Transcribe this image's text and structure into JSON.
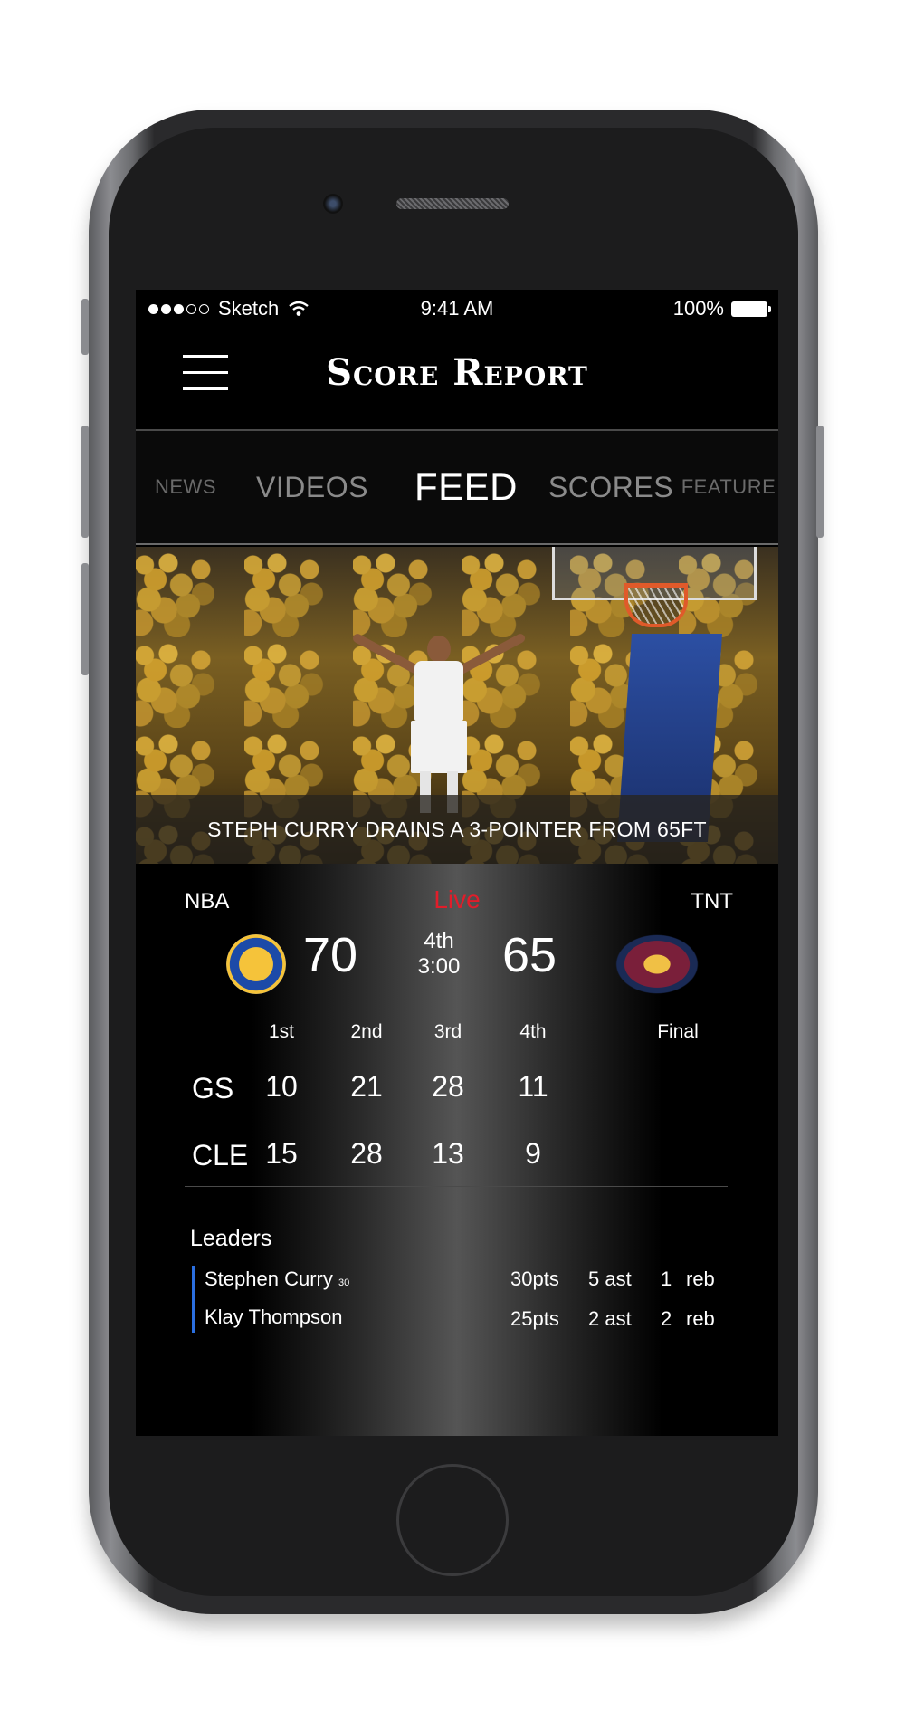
{
  "status_bar": {
    "carrier": "Sketch",
    "time": "9:41 AM",
    "battery": "100%",
    "signal_dots_filled": 3,
    "signal_dots_total": 5
  },
  "header": {
    "title": "Score Report",
    "menu_icon": "hamburger-icon"
  },
  "tabs": [
    {
      "label": "NEWS",
      "active": false
    },
    {
      "label": "VIDEOS",
      "active": false
    },
    {
      "label": "FEED",
      "active": true
    },
    {
      "label": "SCORES",
      "active": false
    },
    {
      "label": "FEATURE",
      "active": false
    }
  ],
  "hero": {
    "caption": "STEPH CURRY DRAINS A 3-POINTER FROM 65FT"
  },
  "game": {
    "league": "NBA",
    "status": "Live",
    "network": "TNT",
    "home": {
      "abbr": "GS",
      "score": "70",
      "logo": "warriors-logo-icon"
    },
    "away": {
      "abbr": "CLE",
      "score": "65",
      "logo": "cavaliers-logo-icon"
    },
    "period": "4th",
    "clock": "3:00",
    "quarter_headers": [
      "1st",
      "2nd",
      "3rd",
      "4th",
      "Final"
    ],
    "lines": [
      {
        "team": "GS",
        "q": [
          "10",
          "21",
          "28",
          "11"
        ]
      },
      {
        "team": "CLE",
        "q": [
          "15",
          "28",
          "13",
          "9"
        ]
      }
    ]
  },
  "leaders": {
    "title": "Leaders",
    "rows": [
      {
        "name": "Stephen Curry",
        "number": "30",
        "pts": "30pts",
        "ast": "5 ast",
        "reb_num": "1",
        "reb_label": "reb"
      },
      {
        "name": "Klay Thompson",
        "number": "",
        "pts": "25pts",
        "ast": "2 ast",
        "reb_num": "2",
        "reb_label": "reb"
      }
    ]
  },
  "colors": {
    "live": "#e11d2a",
    "accent": "#2b6fe0",
    "background": "#000000"
  }
}
